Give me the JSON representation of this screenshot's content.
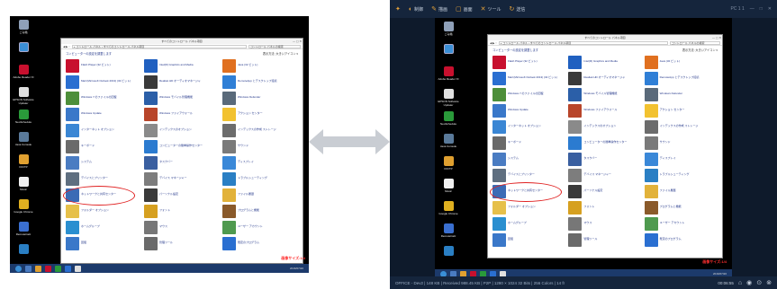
{
  "desktop": {
    "icons": [
      "ごみ箱",
      "",
      "Adobe Reader XI",
      "EPSON Software Updater",
      "NeoSchedule",
      "Java Console",
      "FFFTP",
      "Music",
      "Google Chrome",
      "RemoteCalc",
      ""
    ],
    "window_title": "すべてのコントロール パネル項目",
    "address": "« コントロール パネル › すべてのコントロール パネル項目",
    "search_placeholder": "コントロール パネルの検索",
    "heading": "コンピューターの設定を調整します",
    "view_by": "表示方法: 大きいアイコン ▾",
    "items": [
      {
        "label": "Flash Player (32 ビット)",
        "color": "#c8102e"
      },
      {
        "label": "Intel(R) Graphics and Media",
        "color": "#2060c0"
      },
      {
        "label": "Java (32 ビット)",
        "color": "#e07020"
      },
      {
        "label": "Mail (Microsoft Outlook 2013) (32 ビット)",
        "color": "#2a6fd1"
      },
      {
        "label": "Realtek HD オーディオマネージャ",
        "color": "#3a3a3a"
      },
      {
        "label": "RemoteApp とデスクトップ接続",
        "color": "#2f7fd6"
      },
      {
        "label": "Windows 7 のファイルの回復",
        "color": "#4d8f3a"
      },
      {
        "label": "Windows モバイル管理機能",
        "color": "#2b5fa8"
      },
      {
        "label": "Windows Defender",
        "color": "#5a6a7a"
      },
      {
        "label": "Windows Update",
        "color": "#3a78c9"
      },
      {
        "label": "Windows ファイアウォール",
        "color": "#b8452a"
      },
      {
        "label": "アクション センター",
        "color": "#f2c230"
      },
      {
        "label": "インターネット オプション",
        "color": "#3a86d4"
      },
      {
        "label": "インデックスのオプション",
        "color": "#8a8a8a"
      },
      {
        "label": "インデックスの作成 ストレージ",
        "color": "#6c6c6c"
      },
      {
        "label": "キーボード",
        "color": "#6a6a6a"
      },
      {
        "label": "コンピューターの簡単操作センター",
        "color": "#2b7bd0"
      },
      {
        "label": "サウンド",
        "color": "#7a7a7a"
      },
      {
        "label": "システム",
        "color": "#4a7cc2"
      },
      {
        "label": "タスクバー",
        "color": "#3a5fa0"
      },
      {
        "label": "ディスプレイ",
        "color": "#3a88d8"
      },
      {
        "label": "デバイスとプリンター",
        "color": "#5f6f80"
      },
      {
        "label": "デバイス マネージャー",
        "color": "#7d7d7d"
      },
      {
        "label": "トラブルシューティング",
        "color": "#2a7fc4"
      },
      {
        "label": "ネットワークと共有センター",
        "color": "#3b6bb5"
      },
      {
        "label": "パーソナル設定",
        "color": "#3a3a3a"
      },
      {
        "label": "ファイル履歴",
        "color": "#e2b23a"
      },
      {
        "label": "フォルダー オプション",
        "color": "#e6c04a"
      },
      {
        "label": "フォント",
        "color": "#d6a020"
      },
      {
        "label": "プログラムと機能",
        "color": "#8a5a2a"
      },
      {
        "label": "ホームグループ",
        "color": "#2a8fd0"
      },
      {
        "label": "マウス",
        "color": "#777777"
      },
      {
        "label": "ユーザー アカウント",
        "color": "#4f9a4f"
      },
      {
        "label": "回復",
        "color": "#3a78c9"
      },
      {
        "label": "管理ツール",
        "color": "#6a6a6a"
      },
      {
        "label": "既定のプログラム",
        "color": "#2a6fd1"
      }
    ],
    "taskbar_icons": [
      "#4a7cc2",
      "#e0a030",
      "#c8102e",
      "#2a9a3a",
      "#2a6fd1",
      "#e0e0e0"
    ],
    "clock": "2016/07/20",
    "watermark": "画像サイズ:1/4"
  },
  "toolbar": {
    "items": [
      {
        "icon": "◐",
        "label": "制御"
      },
      {
        "icon": "✎",
        "label": "描画"
      },
      {
        "icon": "▢",
        "label": "画面"
      },
      {
        "icon": "✕",
        "label": "ツール"
      },
      {
        "icon": "↻",
        "label": "送信"
      }
    ],
    "right": [
      "PC 1 1",
      "—",
      "□",
      "✕"
    ]
  },
  "status": {
    "text": "OFFICE - Dev2 | 148 KB | Received 988.45 KB | P2P | 1280 × 1024 32 Bits | 256 Colors | 14 fr",
    "time": "00:06:55",
    "icons": [
      "⌂",
      "◉",
      "⊙",
      "⊗"
    ]
  }
}
